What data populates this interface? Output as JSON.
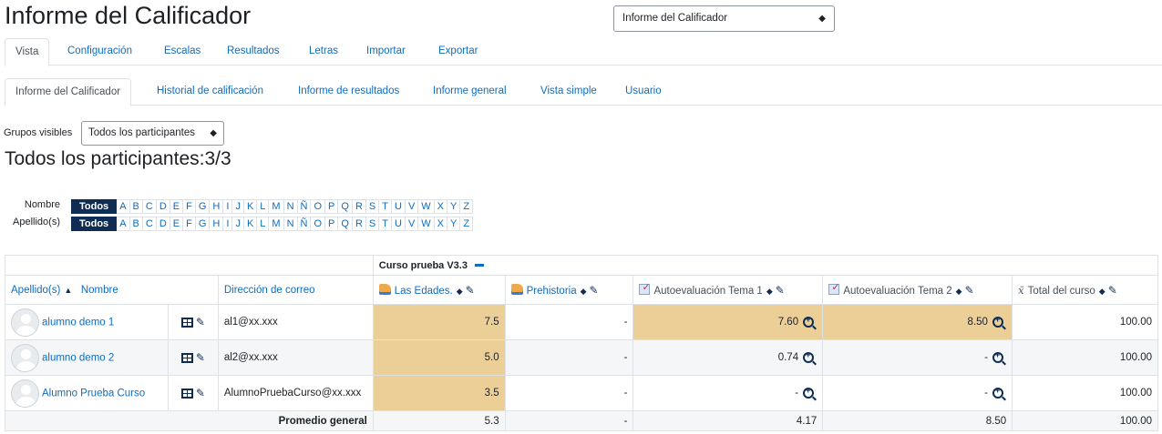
{
  "header": {
    "title": "Informe del Calificador",
    "report_select": "Informe del Calificador"
  },
  "tabs_primary": [
    "Vista",
    "Configuración",
    "Escalas",
    "Resultados",
    "Letras",
    "Importar",
    "Exportar"
  ],
  "tabs_secondary": [
    "Informe del Calificador",
    "Historial de calificación",
    "Informe de resultados",
    "Informe general",
    "Vista simple",
    "Usuario"
  ],
  "groups": {
    "label": "Grupos visibles",
    "selected": "Todos los participantes"
  },
  "participants_heading": "Todos los participantes:3/3",
  "initials": {
    "first_label": "Nombre",
    "last_label": "Apellido(s)",
    "all": "Todos",
    "letters": [
      "A",
      "B",
      "C",
      "D",
      "E",
      "F",
      "G",
      "H",
      "I",
      "J",
      "K",
      "L",
      "M",
      "N",
      "Ñ",
      "O",
      "P",
      "Q",
      "R",
      "S",
      "T",
      "U",
      "V",
      "W",
      "X",
      "Y",
      "Z"
    ]
  },
  "table": {
    "category": "Curso prueba V3.3",
    "headers": {
      "name": "Apellido(s)",
      "name2": "Nombre",
      "email": "Dirección de correo",
      "items": [
        "Las Edades.",
        "Prehistoria",
        "Autoevaluación Tema 1",
        "Autoevaluación Tema 2"
      ],
      "total": "Total del curso"
    },
    "rows": [
      {
        "name": "alumno demo 1",
        "email": "al1@xx.xxx",
        "g1": "7.5",
        "g2": "-",
        "g3": "7.60",
        "g4": "8.50",
        "total": "100.00"
      },
      {
        "name": "alumno demo 2",
        "email": "al2@xx.xxx",
        "g1": "5.0",
        "g2": "-",
        "g3": "0.74",
        "g4": "-",
        "total": "100.00"
      },
      {
        "name": "Alumno Prueba Curso",
        "email": "AlumnoPruebaCurso@xx.xxx",
        "g1": "3.5",
        "g2": "-",
        "g3": "-",
        "g4": "-",
        "total": "100.00"
      }
    ],
    "average": {
      "label": "Promedio general",
      "g1": "5.3",
      "g2": "-",
      "g3": "4.17",
      "g4": "8.50",
      "total": "100.00"
    }
  },
  "colors": {
    "link": "#0f6cbf",
    "highlight": "#ecce97",
    "dark": "#0f2d52"
  }
}
